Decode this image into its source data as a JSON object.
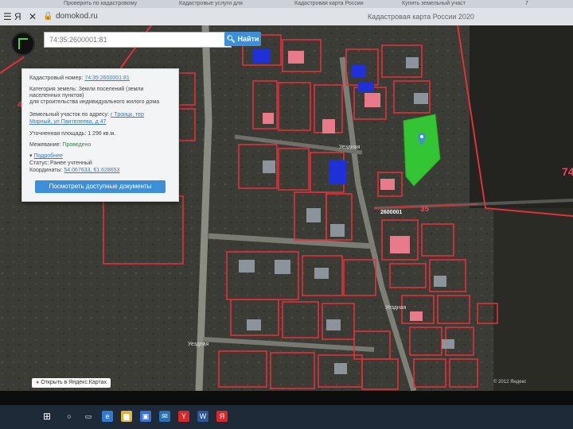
{
  "browser": {
    "tabs": [
      "Проверить по кадастровому",
      "Кадастровые услуги для",
      "Кадастровая карта России",
      "Купить земельный участ",
      "7"
    ],
    "url": "domokod.ru",
    "page_title": "Кадастровая карта России 2020"
  },
  "search": {
    "value": "74:35:2600001:81",
    "button_label": "Найти"
  },
  "info_panel": {
    "cadastral_number_label": "Кадастровый номер:",
    "cadastral_number_value": "74:35:2600001:81",
    "land_category_label": "Категория земель:",
    "land_category_value": "Земли поселений (земли населенных пунктов)",
    "purpose": "для строительства индивидуального жилого дома",
    "address_label": "Земельный участок по адресу:",
    "address_value_1": "г Троицк, тер",
    "address_value_2": "Мирный, ул Пантелеева, д 47",
    "area_label": "Уточненная площадь:",
    "area_value": "1 296 кв.м.",
    "boundary_label": "Межевание:",
    "boundary_value": "Проведено",
    "details_toggle": "Подробнее",
    "status_label": "Статус:",
    "status_value": "Ранее учтенный",
    "coords_label": "Координаты:",
    "coords_value": "54.067633, 61.628653",
    "docs_button": "Посмотреть доступные документы"
  },
  "map": {
    "big_labels": [
      "74:",
      "4",
      "35"
    ],
    "street_labels": [
      "Уездная",
      "Уездная",
      "Уездная"
    ],
    "block_label": "2600001",
    "bottom_link": "Открыть в Яндекс.Картах",
    "copyright": "© 2012 Яндекс"
  },
  "taskbar": {
    "icons": [
      "windows-icon",
      "search-icon",
      "task-view-icon",
      "edge-icon",
      "explorer-icon",
      "store-icon",
      "yandex-icon",
      "word-icon",
      "mail-icon",
      "yandex-browser-icon"
    ]
  },
  "colors": {
    "accent": "#3c8fd8",
    "parcel_border": "#e0303a",
    "selected_parcel": "#33dd33"
  }
}
